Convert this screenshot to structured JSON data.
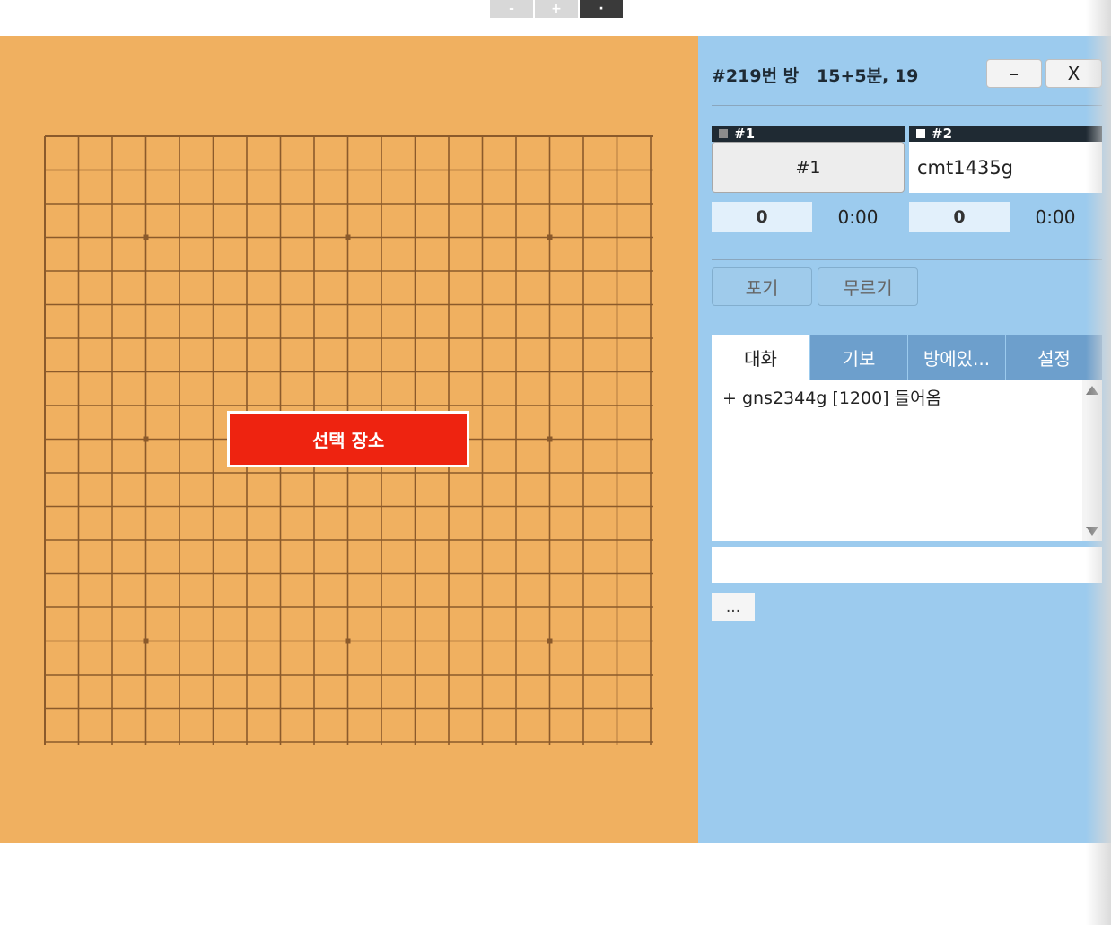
{
  "zoom": {
    "minus_label": "-",
    "plus_label": "+",
    "dot_label": "·"
  },
  "board": {
    "size": 19,
    "star_points": [
      [
        3,
        3
      ],
      [
        3,
        9
      ],
      [
        3,
        15
      ],
      [
        9,
        3
      ],
      [
        9,
        15
      ],
      [
        15,
        3
      ],
      [
        15,
        9
      ],
      [
        15,
        15
      ]
    ],
    "background_color": "#f0b060",
    "line_color": "#8b5a2b",
    "select_button_label": "선택 장소"
  },
  "room": {
    "title": "#219번 방   15+5분, 19",
    "minimize_label": "–",
    "close_label": "X"
  },
  "players": [
    {
      "tag": "#1",
      "name": "#1",
      "score": "0",
      "time": "0:00",
      "color_icon": "gray-square-icon"
    },
    {
      "tag": "#2",
      "name": "cmt1435g",
      "score": "0",
      "time": "0:00",
      "color_icon": "white-square-icon"
    }
  ],
  "actions": {
    "resign_label": "포기",
    "undo_label": "무르기"
  },
  "tabs": [
    {
      "label": "대화",
      "active": true
    },
    {
      "label": "기보",
      "active": false
    },
    {
      "label": "방에있...",
      "active": false
    },
    {
      "label": "설정",
      "active": false
    }
  ],
  "chat": {
    "messages": [
      "+ gns2344g [1200] 들어옴"
    ],
    "input_value": ""
  },
  "more_label": "..."
}
